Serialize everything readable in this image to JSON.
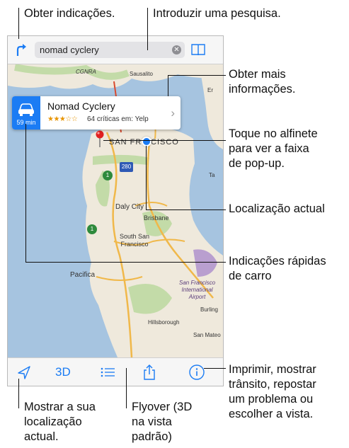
{
  "callouts": {
    "directions": "Obter indicações.",
    "search": "Introduzir uma pesquisa.",
    "more_info": [
      "Obter mais",
      "informações."
    ],
    "tap_pin": [
      "Toque no alfinete",
      "para ver a faixa",
      "de pop-up."
    ],
    "current_location": "Localização actual",
    "quick_directions": [
      "Indicações rápidas",
      "de carro"
    ],
    "print_options": [
      "Imprimir, mostrar",
      "trânsito, repostar",
      "um problema ou",
      "escolher a vista."
    ],
    "show_location": [
      "Mostrar a sua",
      "localização",
      "actual."
    ],
    "flyover": [
      "Flyover (3D",
      "na vista",
      "padrão)"
    ]
  },
  "search": {
    "value": "nomad cyclery"
  },
  "popup": {
    "name": "Nomad Cyclery",
    "stars": "★★★☆☆",
    "reviews": "64 críticas em: Yelp",
    "eta": "59 min"
  },
  "map_labels": {
    "cgnra": "CGNRA",
    "sausalito": "Sausalito",
    "sf_left": "SAN FR",
    "sf_right": "CISCO",
    "hwy280": "280",
    "hwy1a": "1",
    "hwy1b": "1",
    "daly_city": "Daly City",
    "brisbane": "Brisbane",
    "south_sf": [
      "South San",
      "Francisco"
    ],
    "pacifica": "Pacifica",
    "airport": [
      "San Francisco",
      "International",
      "Airport"
    ],
    "burlingame": "Burling",
    "hillsborough": "Hillsborough",
    "san_mateo": "San Mateo",
    "er": "Er",
    "ta": "Ta"
  },
  "toolbar": {
    "label_3d": "3D"
  },
  "colors": {
    "accent": "#1b7cf4",
    "water": "#a6c4e0",
    "land": "#efe9dc",
    "park": "#c3dba8",
    "pin": "#e02020"
  },
  "icons": [
    "directions-icon",
    "bookmarks-icon",
    "clear-icon",
    "car-icon",
    "location-arrow-icon",
    "list-icon",
    "share-icon",
    "info-icon",
    "chevron-right-icon"
  ]
}
